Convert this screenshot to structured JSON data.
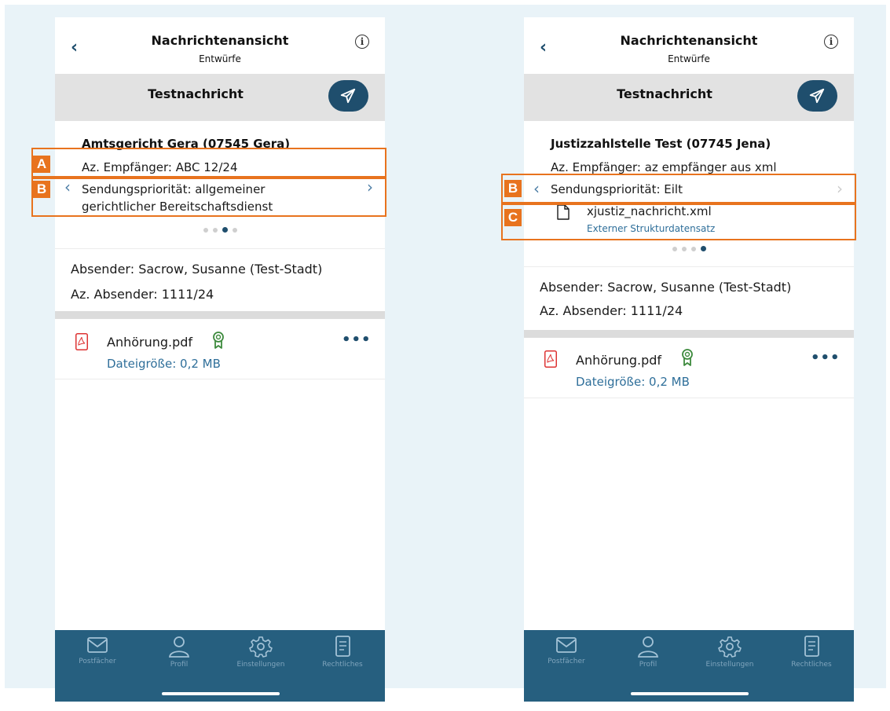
{
  "colors": {
    "primary": "#1f4e6d",
    "tabbar": "#265f7f",
    "link": "#2f6f9a",
    "highlight": "#e8731e",
    "background": "#e9f3f8"
  },
  "screens": [
    {
      "nav": {
        "title": "Nachrichtenansicht",
        "subtitle": "Entwürfe",
        "info_icon": "i"
      },
      "subject": "Testnachricht",
      "recipient": "Amtsgericht Gera (07545 Gera)",
      "az_recipient": "Az. Empfänger: ABC 12/24",
      "priority_line1": "Sendungspriorität: allgemeiner",
      "priority_line2": "gerichtlicher Bereitschaftsdienst",
      "page_indicator": {
        "count": 4,
        "active": 3
      },
      "sender": "Absender: Sacrow, Susanne (Test-Stadt)",
      "az_sender": "Az. Absender: 1111/24",
      "attachment": {
        "name": "Anhörung.pdf",
        "size": "Dateigröße: 0,2 MB",
        "more": "•••"
      },
      "highlights": [
        "A",
        "B"
      ]
    },
    {
      "nav": {
        "title": "Nachrichtenansicht",
        "subtitle": "Entwürfe",
        "info_icon": "i"
      },
      "subject": "Testnachricht",
      "recipient": "Justizzahlstelle Test (07745 Jena)",
      "az_recipient": "Az. Empfänger: az empfänger aus xml",
      "priority": "Sendungspriorität: Eilt",
      "file": {
        "name": "xjustiz_nachricht.xml",
        "type": "Externer Strukturdatensatz"
      },
      "page_indicator": {
        "count": 4,
        "active": 4
      },
      "sender": "Absender: Sacrow, Susanne (Test-Stadt)",
      "az_sender": "Az. Absender: 1111/24",
      "attachment": {
        "name": "Anhörung.pdf",
        "size": "Dateigröße: 0,2 MB",
        "more": "•••"
      },
      "highlights": [
        "B",
        "C"
      ]
    }
  ],
  "tabs": [
    {
      "label": "Postfächer",
      "icon": "mail-icon"
    },
    {
      "label": "Profil",
      "icon": "person-icon"
    },
    {
      "label": "Einstellungen",
      "icon": "gear-icon"
    },
    {
      "label": "Rechtliches",
      "icon": "document-icon"
    }
  ]
}
